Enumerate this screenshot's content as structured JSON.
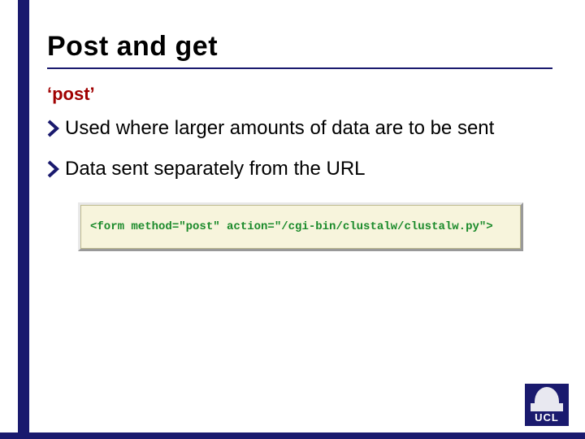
{
  "title": "Post and get",
  "subhead": "‘post’",
  "bullets": [
    "Used where larger amounts of data are to be sent",
    "Data sent separately from the URL"
  ],
  "code": "<form method=\"post\" action=\"/cgi-bin/clustalw/clustalw.py\">",
  "logo_text": "UCL"
}
